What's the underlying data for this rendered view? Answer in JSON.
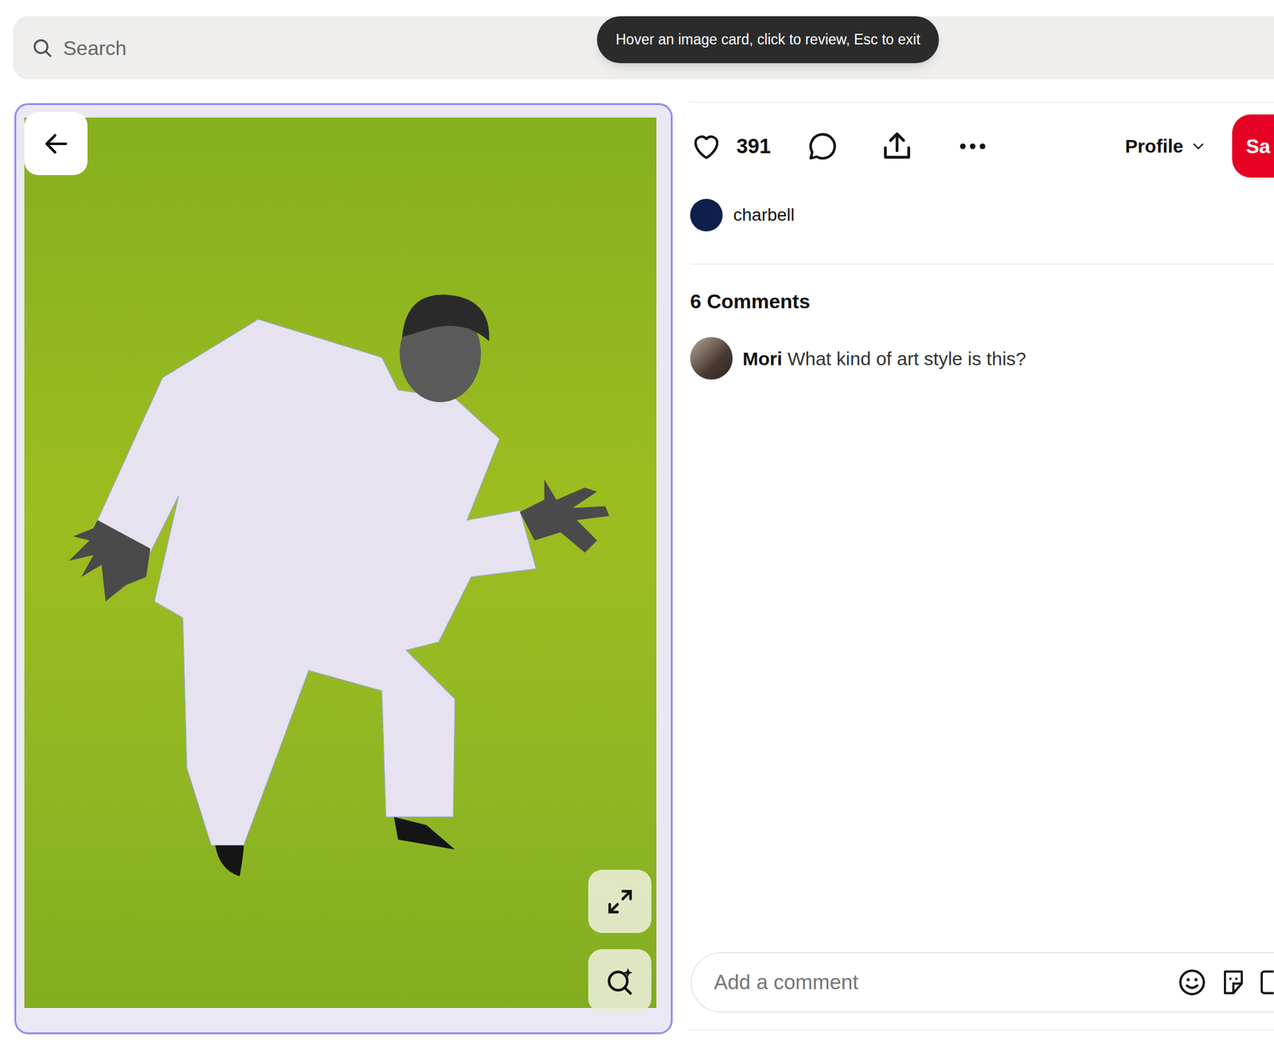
{
  "search": {
    "placeholder": "Search"
  },
  "tooltip": {
    "text": "Hover an image card, click to review, Esc to exit"
  },
  "pin": {
    "likes": "391",
    "liked": false
  },
  "profile_menu": {
    "label": "Profile"
  },
  "save_button": {
    "label": "Sa"
  },
  "author": {
    "name": "charbell"
  },
  "comments": {
    "count_label": "6 Comments",
    "items": [
      {
        "author": "Mori",
        "text": "What kind of art style is this?"
      }
    ]
  },
  "comment_input": {
    "placeholder": "Add a comment"
  }
}
